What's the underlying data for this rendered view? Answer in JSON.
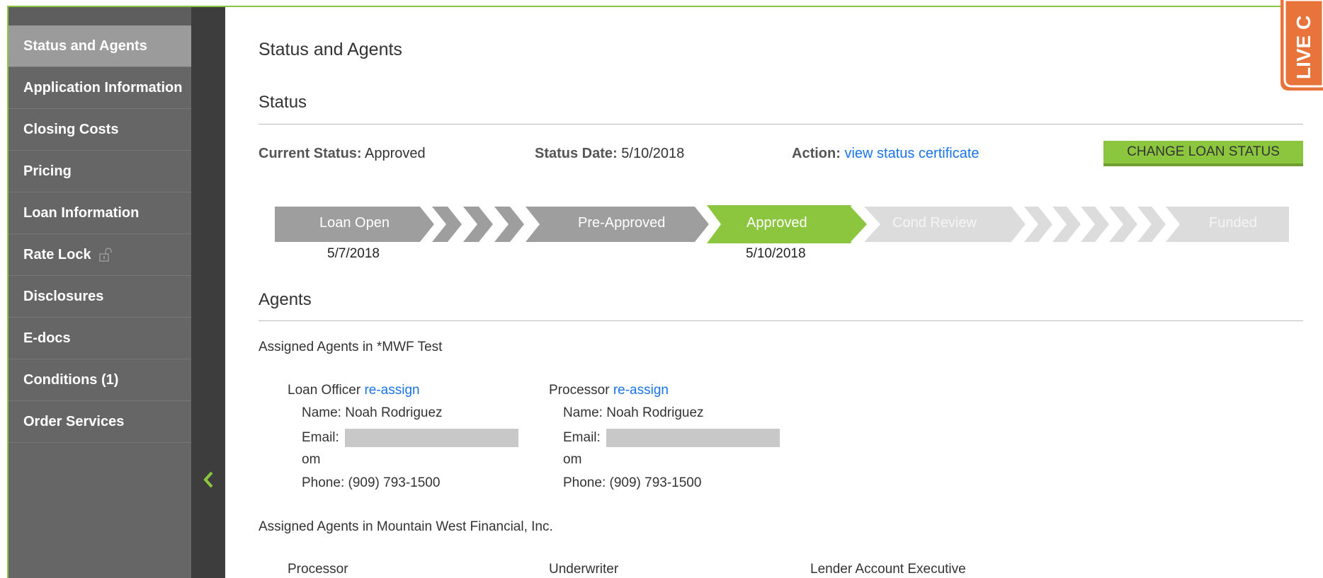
{
  "sidebar": {
    "items": [
      {
        "label": "Status and Agents",
        "active": true
      },
      {
        "label": "Application Information"
      },
      {
        "label": "Closing Costs"
      },
      {
        "label": "Pricing"
      },
      {
        "label": "Loan Information"
      },
      {
        "label": "Rate Lock",
        "icon": "lock-open-icon"
      },
      {
        "label": "Disclosures"
      },
      {
        "label": "E-docs"
      },
      {
        "label": "Conditions (1)"
      },
      {
        "label": "Order Services"
      }
    ]
  },
  "page": {
    "title": "Status and Agents"
  },
  "status": {
    "section_title": "Status",
    "current_status_label": "Current Status:",
    "current_status_value": "Approved",
    "status_date_label": "Status Date:",
    "status_date_value": "5/10/2018",
    "action_label": "Action:",
    "action_link": "view status certificate",
    "change_button": "CHANGE LOAN STATUS"
  },
  "progress": {
    "steps": [
      {
        "label": "Loan Open",
        "date": "5/7/2018",
        "state": "done"
      },
      {
        "label": "Pre-Approved",
        "date": "",
        "state": "done"
      },
      {
        "label": "Approved",
        "date": "5/10/2018",
        "state": "current"
      },
      {
        "label": "Cond Review",
        "date": "",
        "state": "pending"
      },
      {
        "label": "Funded",
        "date": "",
        "state": "pending"
      }
    ]
  },
  "agents": {
    "section_title": "Agents",
    "group1_title": "Assigned Agents in *MWF Test",
    "loan_officer": {
      "role": "Loan Officer",
      "reassign": "re-assign",
      "name": "Name: Noah Rodriguez",
      "email_label": "Email:",
      "email_tail": "om",
      "phone": "Phone: (909) 793-1500"
    },
    "processor": {
      "role": "Processor",
      "reassign": "re-assign",
      "name": "Name: Noah Rodriguez",
      "email_label": "Email:",
      "email_tail": "om",
      "phone": "Phone: (909) 793-1500"
    },
    "group2_title": "Assigned Agents in Mountain West Financial, Inc.",
    "group2_roles": [
      "Processor",
      "Underwriter",
      "Lender Account Executive"
    ]
  },
  "live_chat": {
    "label": "LIVE C"
  },
  "colors": {
    "accent": "#8cc63f",
    "link": "#1a73e8",
    "sidebar": "#666666",
    "step_done": "#9e9e9e",
    "step_pending": "#dcdcdc"
  }
}
